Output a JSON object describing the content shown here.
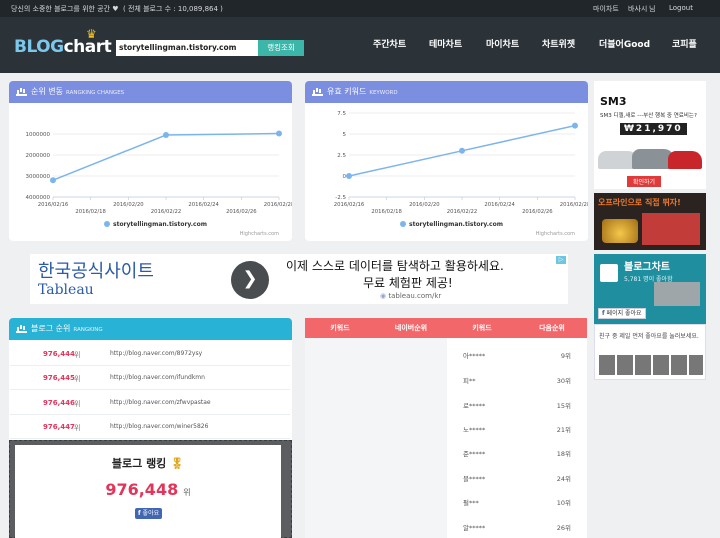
{
  "topbar": {
    "tagline": "당신의 소중한 블로그를 위한 공간 ♥",
    "count_label": "( 전체 블로그 수 : 10,089,864 )",
    "links": [
      "마이차트",
      "바사시",
      "님",
      "Logout"
    ]
  },
  "header": {
    "logo_blog": "BLOG",
    "logo_chart": "chart",
    "search_value": "storytellingman.tistory.com",
    "search_button": "랭킹조회",
    "nav": [
      "주간차트",
      "테마차트",
      "마이차트",
      "차트위젯",
      "더블어Good",
      "코피플"
    ]
  },
  "rank_chart": {
    "title": "순위 변동",
    "subtitle": "RANGKING CHANGES",
    "credit": "Highcharts.com"
  },
  "keyword_chart": {
    "title": "유효 키워드",
    "subtitle": "KEYWORD",
    "credit": "Highcharts.com"
  },
  "chart_data": [
    {
      "type": "line",
      "x": [
        "2016/02/16",
        "2016/02/18",
        "2016/02/20",
        "2016/02/22",
        "2016/02/24",
        "2016/02/26",
        "2016/02/28"
      ],
      "ylim": [
        4000000,
        0
      ],
      "yticks": [
        "1000000",
        "2000000",
        "3000000",
        "4000000"
      ],
      "series": [
        {
          "name": "storytellingman.tistory.com",
          "points": [
            [
              "2016/02/16",
              3200000
            ],
            [
              "2016/02/22",
              1050000
            ],
            [
              "2016/02/28",
              976448
            ]
          ]
        }
      ],
      "color": "#7cb5ec"
    },
    {
      "type": "line",
      "x": [
        "2016/02/16",
        "2016/02/18",
        "2016/02/20",
        "2016/02/22",
        "2016/02/24",
        "2016/02/26",
        "2016/02/28"
      ],
      "ylim": [
        -2.5,
        7.5
      ],
      "yticks": [
        "7.5",
        "5",
        "2.5",
        "0",
        "-2.5"
      ],
      "series": [
        {
          "name": "storytellingman.tistory.com",
          "points": [
            [
              "2016/02/16",
              0
            ],
            [
              "2016/02/22",
              3
            ],
            [
              "2016/02/28",
              6
            ]
          ]
        }
      ],
      "color": "#7cb5ec"
    }
  ],
  "ad": {
    "headline": "한국공식사이트",
    "brand": "Tableau",
    "text1": "이제 스스로 데이터를 탐색하고 활용하세요.",
    "text2": "무료 체험판 제공!",
    "domain": "tableau.com/kr"
  },
  "blog_rank": {
    "title": "블로그 순위",
    "subtitle": "RANGKING",
    "unit": "위",
    "rows": [
      {
        "rank": "976,444",
        "url": "http://blog.naver.com/8972ysy"
      },
      {
        "rank": "976,445",
        "url": "http://blog.naver.com/ifundkmn"
      },
      {
        "rank": "976,446",
        "url": "http://blog.naver.com/zfwvpastae"
      },
      {
        "rank": "976,447",
        "url": "http://blog.naver.com/winer5826"
      }
    ],
    "card_title": "블로그 랭킹",
    "card_rank": "976,448",
    "card_unit": "위",
    "like": "좋아요"
  },
  "keyword_table": {
    "headers": [
      "키워드",
      "네이버순위",
      "키워드",
      "다음순위"
    ],
    "rows": [
      {
        "kw": "아*****",
        "rank": "9위"
      },
      {
        "kw": "피**",
        "rank": "30위"
      },
      {
        "kw": "로*****",
        "rank": "15위"
      },
      {
        "kw": "노*****",
        "rank": "21위"
      },
      {
        "kw": "준*****",
        "rank": "18위"
      },
      {
        "kw": "블*****",
        "rank": "24위"
      },
      {
        "kw": "펄***",
        "rank": "10위"
      },
      {
        "kw": "알*****",
        "rank": "26위"
      }
    ]
  },
  "side": {
    "ad1_brand": "SM3 ",
    "ad1_sub": "SM3 디젤,새로 ---부산 행복 중 연료비는?",
    "ad1_price": "₩21,970",
    "ad1_btn": "확인하기",
    "ad2_text": "오프라인으로 직접 뛰자!",
    "ad3_title": "블로그차트",
    "ad3_likes": "5,781 명이 좋아함",
    "ad3_like": "페이지 좋아요",
    "friends": "친구 중 제일 먼저 좋아요를 눌러보세요."
  }
}
